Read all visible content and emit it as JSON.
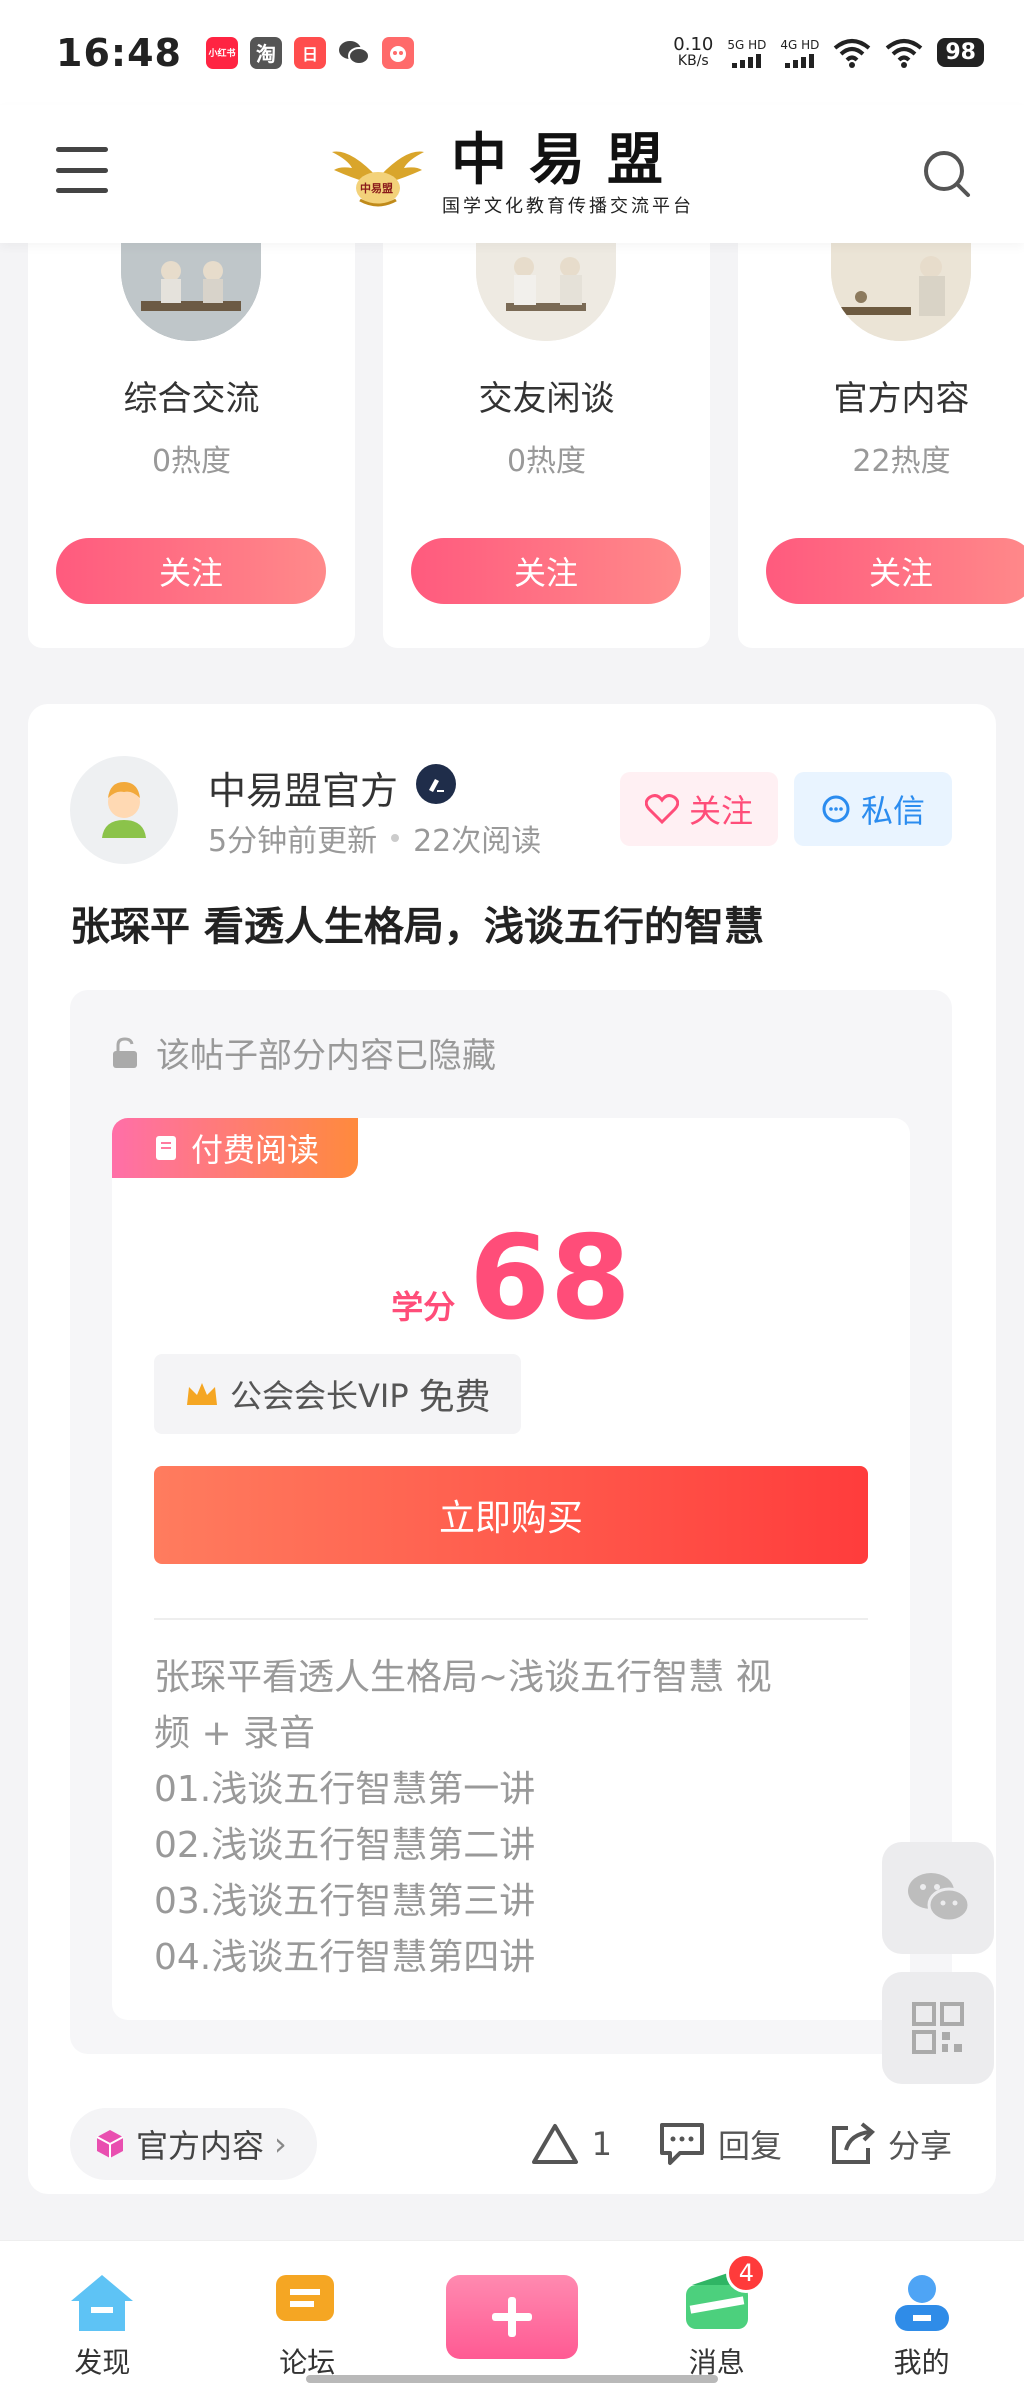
{
  "status_bar": {
    "time": "16:48",
    "apps": [
      {
        "name": "xiaohongshu",
        "label": "小红书",
        "color": "#ff2442"
      },
      {
        "name": "taobao",
        "label": "淘",
        "color": "#555555"
      },
      {
        "name": "calendar",
        "label": "日",
        "color": "#ff4d4d"
      },
      {
        "name": "wechat",
        "label": "",
        "color": "#444444"
      },
      {
        "name": "game",
        "label": "",
        "color": "#ff6a6a"
      }
    ],
    "net_speed_value": "0.10",
    "net_speed_unit": "KB/s",
    "signal1_label": "5G HD",
    "signal2_label": "4G HD",
    "battery": "98"
  },
  "header": {
    "logo_emblem_text": "中易盟",
    "logo_title": "中易盟",
    "logo_subtitle": "国学文化教育传播交流平台"
  },
  "categories": [
    {
      "name": "综合交流",
      "heat": "0热度",
      "follow_label": "关注"
    },
    {
      "name": "交友闲谈",
      "heat": "0热度",
      "follow_label": "关注"
    },
    {
      "name": "官方内容",
      "heat": "22热度",
      "follow_label": "关注"
    }
  ],
  "post": {
    "author": "中易盟官方",
    "updated": "5分钟前更新",
    "reads": "22次阅读",
    "follow_label": "关注",
    "message_label": "私信",
    "title": "张琛平 看透人生格局，浅谈五行的智慧",
    "hidden_notice": "该帖子部分内容已隐藏",
    "paid_tag": "付费阅读",
    "price_unit": "学分",
    "price_value": "68",
    "vip_label": "公会会长VIP",
    "vip_free": "免费",
    "buy_label": "立即购买",
    "description_lines": [
      "张琛平看透人生格局~浅谈五行智慧 视",
      "频 + 录音",
      "01.浅谈五行智慧第一讲",
      "02.浅谈五行智慧第二讲",
      "03.浅谈五行智慧第三讲",
      "04.浅谈五行智慧第四讲"
    ],
    "category_chip": "官方内容",
    "like_count": "1",
    "reply_label": "回复",
    "share_label": "分享"
  },
  "bottom_nav": {
    "items": [
      {
        "label": "发现",
        "icon": "home-icon"
      },
      {
        "label": "论坛",
        "icon": "forum-icon"
      },
      {
        "label": "消息",
        "icon": "wallet-icon",
        "badge": "4"
      },
      {
        "label": "我的",
        "icon": "user-icon"
      }
    ]
  },
  "colors": {
    "accent_pink": "#ff4d79",
    "accent_blue": "#2b8cef",
    "buy_red": "#ff3c3c"
  }
}
